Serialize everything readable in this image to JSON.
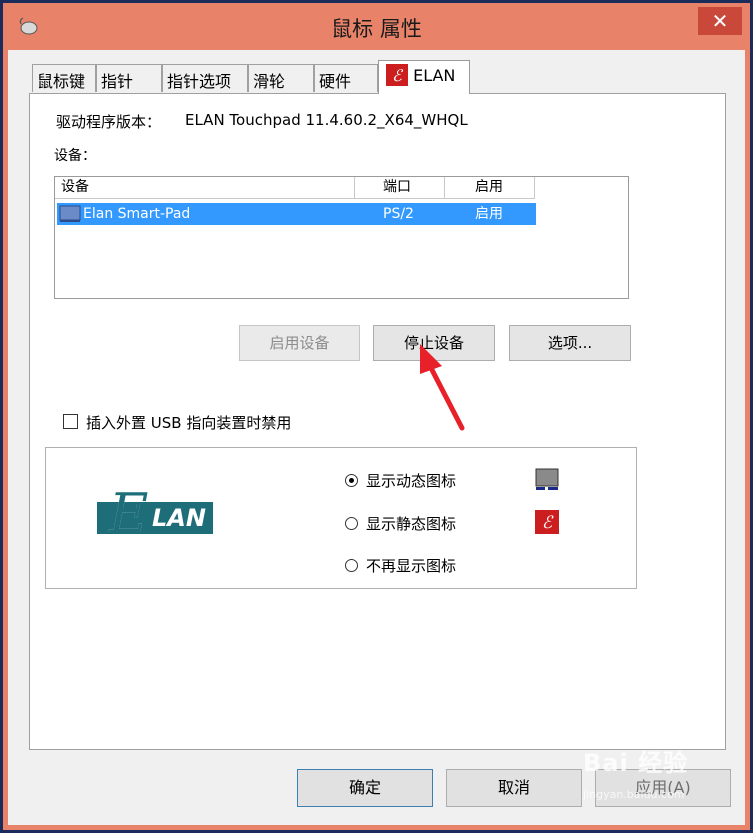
{
  "window": {
    "title": "鼠标 属性",
    "close_glyph": "✕"
  },
  "tabs": [
    {
      "label": "鼠标键"
    },
    {
      "label": "指针"
    },
    {
      "label": "指针选项"
    },
    {
      "label": "滑轮"
    },
    {
      "label": "硬件"
    },
    {
      "label": "ELAN"
    }
  ],
  "elan": {
    "driver_label": "驱动程序版本：",
    "driver_value": "ELAN Touchpad 11.4.60.2_X64_WHQL",
    "devices_label": "设备：",
    "list": {
      "headers": [
        "设备",
        "端口",
        "启用"
      ],
      "rows": [
        {
          "device": "Elan Smart-Pad",
          "port": "PS/2",
          "enabled": "启用"
        }
      ]
    },
    "buttons": {
      "enable": "启用设备",
      "stop": "停止设备",
      "options": "选项..."
    },
    "checkbox_label": "插入外置 USB 指向装置时禁用",
    "checkbox_checked": false,
    "logo_text": "LAN",
    "logo_letter": "E",
    "radios": [
      {
        "label": "显示动态图标",
        "selected": true
      },
      {
        "label": "显示静态图标",
        "selected": false
      },
      {
        "label": "不再显示图标",
        "selected": false
      }
    ]
  },
  "footer": {
    "ok": "确定",
    "cancel": "取消",
    "apply": "应用(A)"
  },
  "watermark": {
    "text": "Bai 经验",
    "sub": "jingyan.baidu.com"
  },
  "colors": {
    "titlebar": "#e8836a",
    "close": "#c9483a",
    "selection": "#3399ff",
    "annotation_arrow": "#e8202a",
    "elan_red": "#cc1e1e",
    "elan_teal": "#1e6e7a"
  },
  "icons": [
    "mouse-icon",
    "close-icon",
    "elan-tab-icon",
    "device-icon",
    "dynamic-icon-preview",
    "static-elan-icon",
    "red-arrow-annotation"
  ]
}
